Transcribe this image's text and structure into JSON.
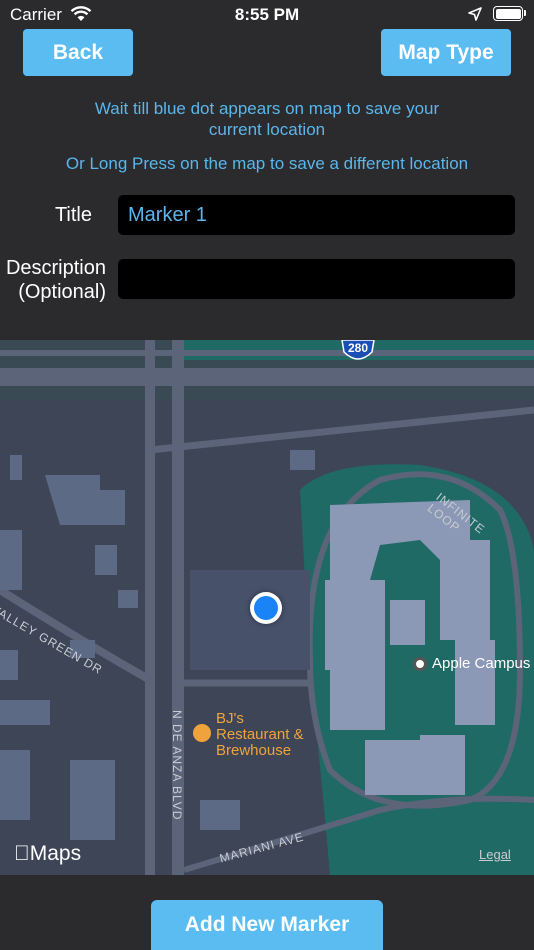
{
  "status_bar": {
    "carrier": "Carrier",
    "time": "8:55 PM"
  },
  "nav": {
    "back_label": "Back",
    "map_type_label": "Map Type"
  },
  "instructions": {
    "line1": "Wait till blue dot appears on map to save your",
    "line1b": "current location",
    "line2": "Or Long Press on the map to save a different location"
  },
  "form": {
    "title_label": "Title",
    "title_value": "Marker 1",
    "description_label_1": "Description",
    "description_label_2": "(Optional)",
    "description_value": ""
  },
  "map": {
    "highway_shield": "280",
    "street_infinite_loop": "INFINITE LOOP",
    "street_valley_green": "VALLEY GREEN DR",
    "street_de_anza": "N DE ANZA BLVD",
    "street_mariani": "MARIANI AVE",
    "poi_bjs_1": "BJ's",
    "poi_bjs_2": "Restaurant &",
    "poi_bjs_3": "Brewhouse",
    "poi_apple": "Apple Campus",
    "attribution": "Maps",
    "legal": "Legal"
  },
  "footer": {
    "add_marker_label": "Add New Marker"
  },
  "colors": {
    "accent": "#5bbcf2",
    "info_text": "#5ab6ec",
    "background": "#2b2b2d",
    "user_location": "#1a84f7"
  }
}
